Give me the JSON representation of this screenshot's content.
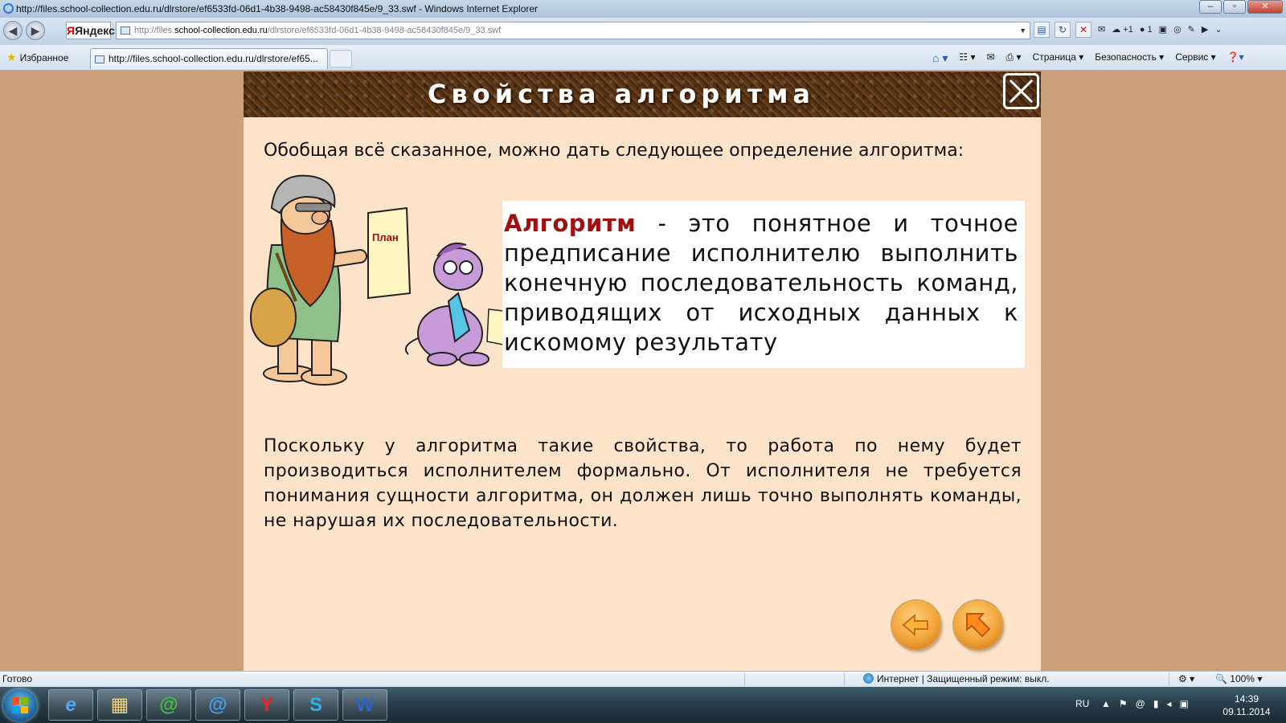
{
  "window": {
    "title": "http://files.school-collection.edu.ru/dlrstore/ef6533fd-06d1-4b38-9498-ac58430f845e/9_33.swf - Windows Internet Explorer"
  },
  "addressbar": {
    "search_provider": "Яндекс",
    "url_prefix": "http://files.",
    "url_host": "school-collection.edu.ru",
    "url_path": "/dlrstore/ef6533fd-06d1-4b38-9498-ac58430f845e/9_33.swf"
  },
  "favorites": {
    "label": "Избранное"
  },
  "tab": {
    "title": "http://files.school-collection.edu.ru/dlrstore/ef65..."
  },
  "commandbar": {
    "page": "Страница",
    "safety": "Безопасность",
    "tools": "Сервис"
  },
  "slide": {
    "title": "Свойства алгоритма",
    "intro": "Обобщая всё сказанное, можно дать следующее определение алгоритма:",
    "illustration_note": "План",
    "definition_term": "Алгоритм",
    "definition_rest": " - это понятное и точное предписание исполнителю выполнить конечную последовательность команд, приводящих от исходных данных к искомому результату",
    "paragraph": "Поскольку у алгоритма такие свойства, то работа по нему будет производиться исполнителем формально. От исполнителя не требуется понимания сущности алгоритма, он должен лишь точно выполнять команды, не нарушая их последовательности."
  },
  "statusbar": {
    "status": "Готово",
    "zone": "Интернет | Защищенный режим: выкл.",
    "zoom": "100%"
  },
  "taskbar": {
    "language": "RU",
    "time": "14:39",
    "date": "09.11.2014"
  },
  "colors": {
    "slide_bg": "#fde3c9",
    "stage_bg": "#c9a07a",
    "term_color": "#a01010",
    "nav_orange": "#f2a43a"
  }
}
